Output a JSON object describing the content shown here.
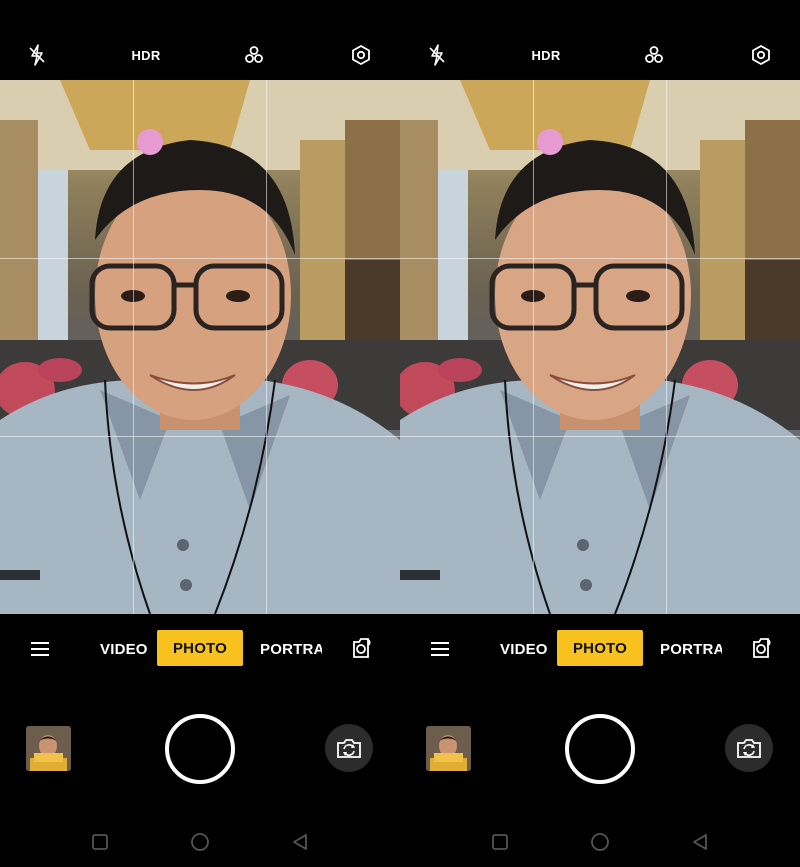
{
  "camera": {
    "top_bar": {
      "flash_icon": "flash-off-icon",
      "hdr_label": "HDR",
      "filter_icon": "filter-icon",
      "settings_icon": "settings-icon"
    },
    "modes": {
      "video": "VIDEO",
      "photo": "PHOTO",
      "portrait": "PORTRAIT",
      "active": "PHOTO"
    },
    "icons": {
      "menu": "hamburger-menu-icon",
      "extra_mode": "beauty-mode-icon",
      "switch_camera": "switch-camera-icon",
      "shutter": "shutter-button",
      "gallery": "gallery-thumbnail"
    },
    "navigation": {
      "recents": "recents-square-icon",
      "home": "home-circle-icon",
      "back": "back-triangle-icon"
    },
    "colors": {
      "accent": "#f7c21d",
      "background": "#000000",
      "icon": "#ffffff"
    }
  }
}
